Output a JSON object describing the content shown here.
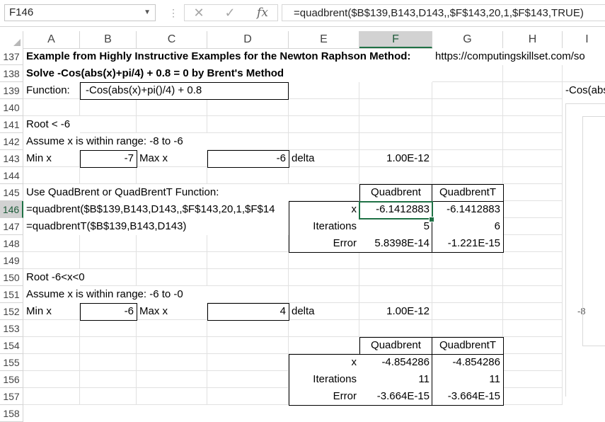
{
  "formula_bar": {
    "name_box": "F146",
    "cancel_icon": "✕",
    "enter_icon": "✓",
    "function_icon": "fx",
    "formula": "=quadbrent($B$139,B143,D143,,$F$143,20,1,$F$143,TRUE)"
  },
  "columns": [
    "A",
    "B",
    "C",
    "D",
    "E",
    "F",
    "G",
    "H",
    "I"
  ],
  "rows": [
    "137",
    "138",
    "139",
    "140",
    "141",
    "142",
    "143",
    "144",
    "145",
    "146",
    "147",
    "148",
    "149",
    "150",
    "151",
    "152",
    "153",
    "154",
    "155",
    "156",
    "157",
    "158"
  ],
  "sheet": {
    "r137": {
      "a": "Example from Highly Instructive Examples for the Newton Raphson Method:",
      "g": "https://computingskillset.com/so"
    },
    "r138": {
      "a": "Solve -Cos(abs(x)+pi/4) + 0.8 = 0 by Brent's Method"
    },
    "r139": {
      "a": "Function:",
      "b": "-Cos(abs(x)+pi()/4) + 0.8",
      "i": "-Cos(abs"
    },
    "r141": {
      "a": "Root < -6"
    },
    "r142": {
      "a": "Assume x is within range: -8 to -6"
    },
    "r143": {
      "a": "Min x",
      "b": "-7",
      "c": "Max x",
      "d": "-6",
      "e": "delta",
      "f": "1.00E-12"
    },
    "r145": {
      "a": "Use QuadBrent or QuadBrentT Function:",
      "f": "Quadbrent",
      "g": "QuadbrentT"
    },
    "r146": {
      "a": "=quadbrent($B$139,B143,D143,,$F$143,20,1,$F$14",
      "e": "x",
      "f": "-6.1412883",
      "g": "-6.1412883"
    },
    "r147": {
      "a": "=quadbrentT($B$139,B143,D143)",
      "e": "Iterations",
      "f": "5",
      "g": "6"
    },
    "r148": {
      "e": "Error",
      "f": "5.8398E-14",
      "g": "-1.221E-15"
    },
    "r150": {
      "a": "Root -6<x<0"
    },
    "r151": {
      "a": "Assume x is within range: -6 to -0"
    },
    "r152": {
      "a": "Min x",
      "b": "-6",
      "c": "Max x",
      "d": "4",
      "e": "delta",
      "f": "1.00E-12",
      "i": "-8"
    },
    "r154": {
      "f": "Quadbrent",
      "g": "QuadbrentT"
    },
    "r155": {
      "e": "x",
      "f": "-4.854286",
      "g": "-4.854286"
    },
    "r156": {
      "e": "Iterations",
      "f": "11",
      "g": "11"
    },
    "r157": {
      "e": "Error",
      "f": "-3.664E-15",
      "g": "-3.664E-15"
    }
  },
  "colors": {
    "selection": "#1f7145",
    "header_active": "#d2d2d2",
    "gridline": "#e1e1e1"
  }
}
